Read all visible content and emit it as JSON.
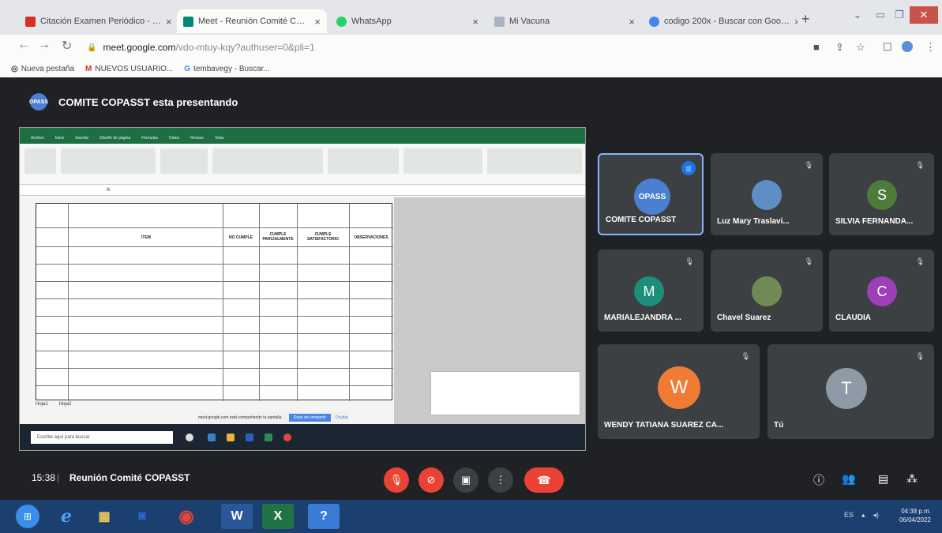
{
  "browser": {
    "tabs": [
      {
        "label": "Citación Examen Periódico - …",
        "icon": "gmail-icon"
      },
      {
        "label": "Meet - Reunión Comité C…",
        "icon": "meet-icon"
      },
      {
        "label": "WhatsApp",
        "icon": "whatsapp-icon"
      },
      {
        "label": "Mi Vacuna",
        "icon": "page-icon"
      },
      {
        "label": "codigo 200x - Buscar con Goo…",
        "icon": "google-icon"
      }
    ],
    "url_host": "meet.google.com",
    "url_path": "/vdo-mtuy-kqy?authuser=0&pli=1",
    "bookmarks": [
      {
        "label": "Nueva pestaña",
        "icon": "globe-icon"
      },
      {
        "label": "NUEVOS USUARIO...",
        "icon": "gmail-icon"
      },
      {
        "label": "tembavegy - Buscar...",
        "icon": "google-icon"
      }
    ]
  },
  "meet": {
    "presenter_avatar_text": "OPASS",
    "presenter_text": "COMITE COPASST esta presentando",
    "meeting_time": "15:38",
    "meeting_separator": "|",
    "meeting_title": "Reunión Comité COPASST"
  },
  "shared_screen": {
    "excel_tabs": [
      "Archivo",
      "Inicio",
      "Insertar",
      "Diseño de página",
      "Fórmulas",
      "Datos",
      "Revisar",
      "Vista"
    ],
    "sheet_tabs": [
      "Hoja1",
      "Hoja2"
    ],
    "share_banner": "meet.google.com está compartiendo tu pantalla.",
    "share_stop": "Dejar de compartir",
    "share_hide": "Ocultar",
    "taskbar_search": "Escribe aquí para buscar",
    "table_headers": [
      "ITEM",
      "NO CUMPLE",
      "CUMPLE PARCIALMENTE",
      "CUMPLE SATISFACTORIO",
      "OBSERVACIONES"
    ]
  },
  "participants": [
    {
      "name": "COMITE COPASST",
      "avatar_text": "OPASS",
      "avatar_color": "#4a7fd1",
      "speaking": true
    },
    {
      "name": "Luz Mary Traslavi...",
      "avatar_text": "",
      "avatar_color": "#5d8fc4",
      "speaking": false
    },
    {
      "name": "SILVIA FERNANDA...",
      "avatar_text": "S",
      "avatar_color": "#4e7a3a",
      "speaking": false
    },
    {
      "name": "MARIALEJANDRA ...",
      "avatar_text": "M",
      "avatar_color": "#1b8f7a",
      "speaking": false
    },
    {
      "name": "Chavel Suarez",
      "avatar_text": "",
      "avatar_color": "#6f8a54",
      "speaking": false
    },
    {
      "name": "CLAUDIA",
      "avatar_text": "C",
      "avatar_color": "#9c3fb8",
      "speaking": false
    },
    {
      "name": "WENDY TATIANA SUAREZ CA...",
      "avatar_text": "W",
      "avatar_color": "#f07b34",
      "speaking": false
    },
    {
      "name": "Tú",
      "avatar_text": "T",
      "avatar_color": "#8e9aa6",
      "speaking": false
    }
  ],
  "taskbar": {
    "apps": [
      "ie-icon",
      "folder-icon",
      "outlook-icon",
      "chrome-icon",
      "word-icon",
      "excel-icon",
      "help-icon"
    ],
    "tray_text": "ES",
    "clock_time": "04:38 p.m.",
    "clock_date": "06/04/2022"
  },
  "colors": {
    "meet_background": "#1f2125",
    "tile_background": "#3c4043",
    "red_button": "#ea4335",
    "taskbar": "#1b3f6e"
  }
}
